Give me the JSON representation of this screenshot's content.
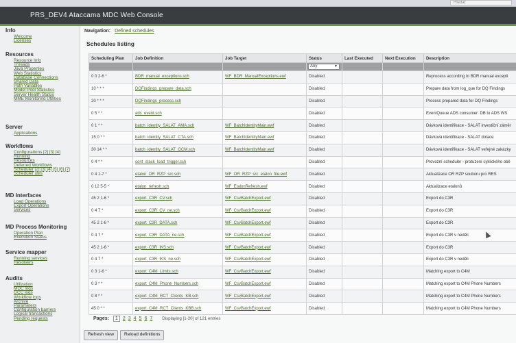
{
  "browser": {
    "search_placeholder": "Hledat"
  },
  "app": {
    "title": "PRS_DEV4 Ataccama MDC Web Console"
  },
  "sidebar": {
    "sections": [
      {
        "title": "Info",
        "items": [
          "Welcome",
          "Licenses"
        ]
      },
      {
        "title": "Resources",
        "items": [
          "Resource Info",
          "Threads",
          "Java Properties",
          "Web Statistics",
          "Database Connections",
          "Shared Data",
          "Path Variables",
          "Model Pool Statistics",
          "Server Health Status",
          "MME Monitoring Utilities"
        ]
      },
      {
        "title": "Server",
        "items": [
          "Applications"
        ]
      },
      {
        "title": "Workflows",
        "items": [
          "Configurations [2] [3] [4]",
          "Running",
          "Resources",
          "Deferred Workflows",
          "Scheduler [2] [3] [4] [5] [6] [7]",
          "Scheduler utils"
        ]
      },
      {
        "title": "MD Interfaces",
        "items": [
          "Load Operations",
          "Export Operations",
          "Services"
        ]
      },
      {
        "title": "MD Process Monitoring",
        "items": [
          "Operation Plan",
          "Execution Status"
        ]
      },
      {
        "title": "Service mapper",
        "items": [
          "Running services",
          "Resolvers"
        ]
      },
      {
        "title": "Audits",
        "items": [
          "Utilization",
          "MDC logs",
          "GCC logs",
          "Workflow logs",
          "Archive",
          "Parameters",
          "Configuration barriers",
          "Logical transactions",
          "Pending requests"
        ]
      }
    ]
  },
  "main": {
    "nav_label": "Navigation:",
    "nav_link": "Defined schedules",
    "listing_title": "Schedules listing",
    "filter_status_value": "Any",
    "columns": [
      "Scheduling Plan",
      "Job Definition",
      "Job Target",
      "Status",
      "Last Executed",
      "Next Execution",
      "Description"
    ],
    "rows": [
      {
        "plan": "0 0 2-6 *",
        "job": "BDR_manual_exceptions.sch",
        "target": "WF_BDR_ManualExceptions.ewf",
        "status": "Disabled",
        "last": "",
        "next": "",
        "desc": "Reprocess according to BDR manual excepti"
      },
      {
        "plan": "10 * * *",
        "job": "DQFindings_prepare_data.sch",
        "target": "",
        "status": "Disabled",
        "last": "",
        "next": "",
        "desc": "Prepare data from log_que for DQ Findings"
      },
      {
        "plan": "20 * * *",
        "job": "DQFindings_process.sch",
        "target": "",
        "status": "Disabled",
        "last": "",
        "next": "",
        "desc": "Process prepared data for DQ Findings"
      },
      {
        "plan": "0 5 * *",
        "job": "ads_event.sch",
        "target": "",
        "status": "Disabled",
        "last": "",
        "next": "",
        "desc": "EventQueue ADS consumer: DB to ADS WS"
      },
      {
        "plan": "0 1 * *",
        "job": "batch_identity_SALAT_AMA.sch",
        "target": "WF_BatchIdentityMain.ewf",
        "status": "Disabled",
        "last": "",
        "next": "",
        "desc": "Dávková identifikace - SALAT investiční záměr"
      },
      {
        "plan": "15 0 * *",
        "job": "batch_identity_SALAT_CTA.sch",
        "target": "WF_BatchIdentityMain.ewf",
        "status": "Disabled",
        "last": "",
        "next": "",
        "desc": "Dávková identifikace - SALAT dotace"
      },
      {
        "plan": "30 14 * *",
        "job": "batch_identity_SALAT_GCM.sch",
        "target": "WF_BatchIdentityMain.ewf",
        "status": "Disabled",
        "last": "",
        "next": "",
        "desc": "Dávková identifikace - SALAT veřejné zakázky"
      },
      {
        "plan": "0 4 * *",
        "job": "cont_stack_load_trigger.sch",
        "target": "",
        "status": "Disabled",
        "last": "",
        "next": "",
        "desc": "Provozní scheduler - protuzení cyklického obě"
      },
      {
        "plan": "0 4 1-7 *",
        "job": "etalon_OR_RZP_src.sch",
        "target": "WF_OR_RZP_src_etalon_file.ewf",
        "status": "Disabled",
        "last": "",
        "next": "",
        "desc": "Aktualizace OR RZP souboru pro RES"
      },
      {
        "plan": "0 12 5-5 *",
        "job": "etalon_refresh.sch",
        "target": "WF_EtalonRefresh.ewf",
        "status": "Disabled",
        "last": "",
        "next": "",
        "desc": "Aktualizace etalonů"
      },
      {
        "plan": "45 2 1-6 *",
        "job": "export_C3R_CV.sch",
        "target": "WF_CsvBatchExport.ewf",
        "status": "Disabled",
        "last": "",
        "next": "",
        "desc": "Export do C3R"
      },
      {
        "plan": "0 4 7 *",
        "job": "export_C3R_CV_ne.sch",
        "target": "WF_CsvBatchExport.ewf",
        "status": "Disabled",
        "last": "",
        "next": "",
        "desc": "Export do C3R"
      },
      {
        "plan": "45 2 1-6 *",
        "job": "export_C3R_DATA.sch",
        "target": "WF_CsvBatchExport.ewf",
        "status": "Disabled",
        "last": "",
        "next": "",
        "desc": "Export do C3R"
      },
      {
        "plan": "0 4 7 *",
        "job": "export_C3R_DATA_ne.sch",
        "target": "WF_CsvBatchExport.ewf",
        "status": "Disabled",
        "last": "",
        "next": "",
        "desc": "Export do C3R v neděli"
      },
      {
        "plan": "45 2 1-6 *",
        "job": "export_C3R_IKS.sch",
        "target": "WF_CsvBatchExport.ewf",
        "status": "Disabled",
        "last": "",
        "next": "",
        "desc": "Export do C3R"
      },
      {
        "plan": "0 4 7 *",
        "job": "export_C3R_IKS_ne.sch",
        "target": "WF_CsvBatchExport.ewf",
        "status": "Disabled",
        "last": "",
        "next": "",
        "desc": "Export do C3R v neděli"
      },
      {
        "plan": "0 3 1-6 *",
        "job": "export_C4M_Limits.sch",
        "target": "WF_CsvBatchExport.ewf",
        "status": "Disabled",
        "last": "",
        "next": "",
        "desc": "Matching export to C4M"
      },
      {
        "plan": "0 3 * *",
        "job": "export_C4M_Phone_Numbers.sch",
        "target": "WF_CsvBatchExport.ewf",
        "status": "Disabled",
        "last": "",
        "next": "",
        "desc": "Matching export to C4M Phone Numbers"
      },
      {
        "plan": "0 8 * *",
        "job": "export_C4M_RCT_Clients_KB.sch",
        "target": "WF_CsvBatchExport.ewf",
        "status": "Disabled",
        "last": "",
        "next": "",
        "desc": "Matching export to C4M Phone Numbers"
      },
      {
        "plan": "45 0 * *",
        "job": "export_C4M_RCT_Clients_KBB.sch",
        "target": "WF_CsvBatchExport.ewf",
        "status": "Disabled",
        "last": "",
        "next": "",
        "desc": "Matching export to C4M Phone Numbers"
      }
    ],
    "pager": {
      "label": "Pages:",
      "pages": [
        "1",
        "2",
        "3",
        "4",
        "5",
        "6",
        "7"
      ],
      "info": "Displaying [1-20] of 121 entries"
    },
    "buttons": {
      "refresh": "Refresh view",
      "reload": "Reload definitions"
    }
  }
}
